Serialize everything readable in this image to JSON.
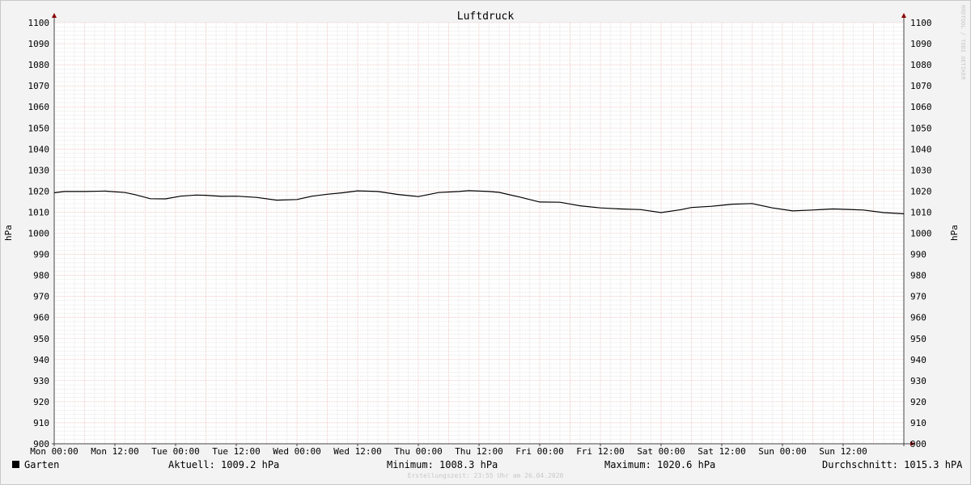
{
  "chart_data": {
    "type": "line",
    "title": "Luftdruck",
    "ylabel": "hPa",
    "ylabel_right": "hPa",
    "ylim": [
      900,
      1100
    ],
    "yticks": [
      900,
      910,
      920,
      930,
      940,
      950,
      960,
      970,
      980,
      990,
      1000,
      1010,
      1020,
      1030,
      1040,
      1050,
      1060,
      1070,
      1080,
      1090,
      1100
    ],
    "xticks": [
      "Mon 00:00",
      "Mon 12:00",
      "Tue 00:00",
      "Tue 12:00",
      "Wed 00:00",
      "Wed 12:00",
      "Thu 00:00",
      "Thu 12:00",
      "Fri 00:00",
      "Fri 12:00",
      "Sat 00:00",
      "Sat 12:00",
      "Sun 00:00",
      "Sun 12:00"
    ],
    "x_unit": "hours since Mon 00:00",
    "xlim": [
      0,
      168
    ],
    "grid": true,
    "series": [
      {
        "name": "Garten",
        "color": "#000000",
        "x": [
          0,
          2,
          6,
          10,
          14,
          16,
          19,
          22,
          25,
          28,
          30,
          33,
          36,
          40,
          44,
          48,
          51,
          54,
          57,
          60,
          64,
          68,
          72,
          76,
          80,
          82,
          86,
          88,
          92,
          96,
          100,
          104,
          108,
          112,
          116,
          120,
          124,
          126,
          130,
          134,
          138,
          142,
          146,
          150,
          152,
          154,
          157,
          160,
          164,
          168
        ],
        "y": [
          1019.2,
          1019.8,
          1019.8,
          1020.0,
          1019.3,
          1018.3,
          1016.4,
          1016.3,
          1017.6,
          1018.1,
          1018.0,
          1017.5,
          1017.6,
          1017.0,
          1015.7,
          1016.0,
          1017.6,
          1018.5,
          1019.2,
          1020.1,
          1019.8,
          1018.4,
          1017.4,
          1019.3,
          1019.8,
          1020.2,
          1019.8,
          1019.4,
          1017.2,
          1014.8,
          1014.7,
          1013.0,
          1012.0,
          1011.5,
          1011.2,
          1009.8,
          1011.2,
          1012.2,
          1012.8,
          1013.8,
          1014.1,
          1012.0,
          1010.6,
          1011.0,
          1011.3,
          1011.5,
          1011.3,
          1011.0,
          1009.8,
          1009.2
        ]
      }
    ]
  },
  "legend": {
    "series_name": "Garten",
    "current": "Aktuell: 1009.2 hPa",
    "minimum": "Minimum: 1008.3 hPa",
    "maximum": "Maximum: 1020.6 hPa",
    "average": "Durchschnitt: 1015.3 hPA"
  },
  "watermark": "RRDTOOL / TOBI OETIKER",
  "footer": "Erstellungszeit: 23:55 Uhr am 26.04.2020"
}
